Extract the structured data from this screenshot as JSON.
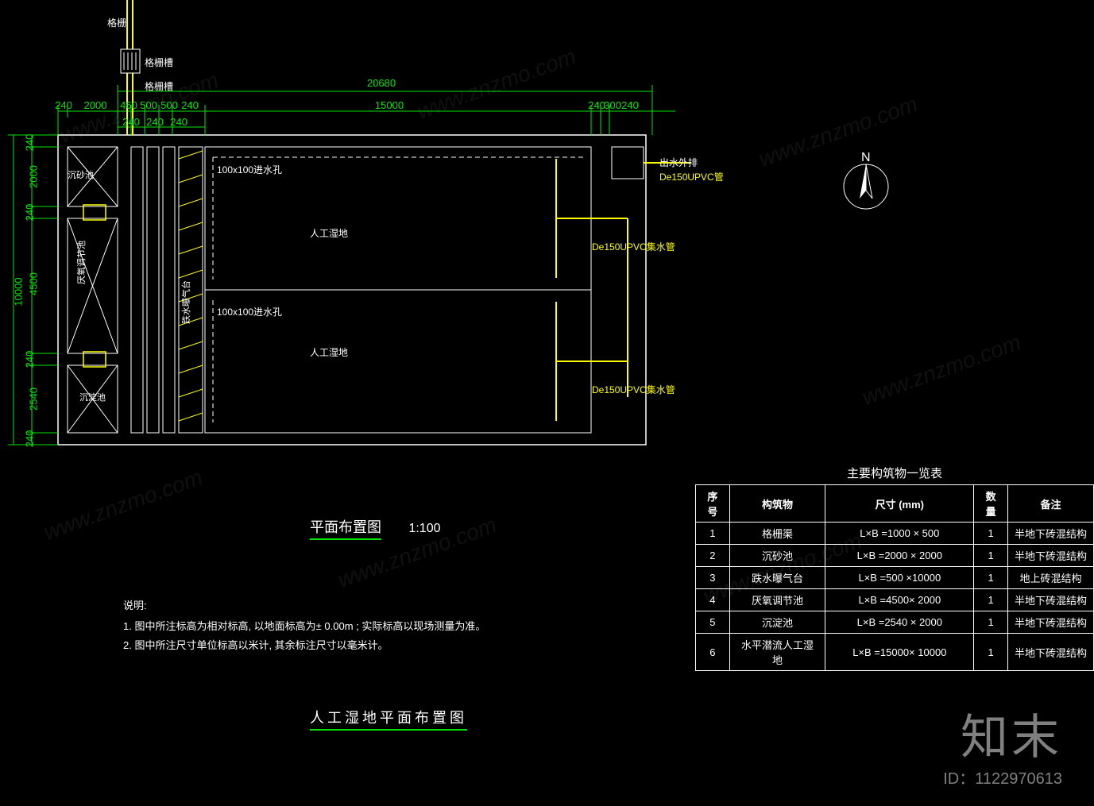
{
  "drawing_title": "人工湿地平面布置图",
  "plan_title": "平面布置图",
  "plan_scale": "1:100",
  "compass": "N",
  "dim_top_overall": "20680",
  "dim_top_segments": [
    "240",
    "2000",
    "460",
    "500",
    "500",
    "240",
    "15000",
    "240",
    "300",
    "240"
  ],
  "dim_top_small": [
    "240",
    "240",
    "240"
  ],
  "dim_left_overall": "10000",
  "dim_left_segments": [
    "240",
    "2000",
    "240",
    "4500",
    "240",
    "2540",
    "240"
  ],
  "labels": {
    "screen_small": "格栅",
    "screen_well": "格栅槽",
    "sump": "沉淀池",
    "wetland": "人工湿地",
    "hole": "100x100进水孔",
    "upvc_pipe": "De150UPVC管",
    "upvc_collect": "De150UPVC集水管",
    "outlet": "出水外排"
  },
  "locals": {
    "sedimentation": "沉砂池",
    "anaerobic": "厌氧调节池",
    "aeration": "跌水曝气台",
    "sedtank": "沉淀池"
  },
  "notes_heading": "说明:",
  "notes": [
    "1.  图中所注标高为相对标高, 以地面标高为±   0.00m   ; 实际标高以现场测量为准。",
    "2.  图中所注尺寸单位标高以米计, 其余标注尺寸以毫米计。"
  ],
  "table_title": "主要构筑物一览表",
  "table_headers": [
    "序号",
    "构筑物",
    "尺寸  (mm)",
    "数量",
    "备注"
  ],
  "table_rows": [
    {
      "n": "1",
      "name": "格栅渠",
      "size": "L×B =1000 × 500",
      "qty": "1",
      "rem": "半地下砖混结构"
    },
    {
      "n": "2",
      "name": "沉砂池",
      "size": "L×B =2000 × 2000",
      "qty": "1",
      "rem": "半地下砖混结构"
    },
    {
      "n": "3",
      "name": "跌水曝气台",
      "size": "L×B =500 ×10000",
      "qty": "1",
      "rem": "地上砖混结构"
    },
    {
      "n": "4",
      "name": "厌氧调节池",
      "size": "L×B =4500× 2000",
      "qty": "1",
      "rem": "半地下砖混结构"
    },
    {
      "n": "5",
      "name": "沉淀池",
      "size": "L×B =2540 ×  2000",
      "qty": "1",
      "rem": "半地下砖混结构"
    },
    {
      "n": "6",
      "name": "水平潜流人工湿地",
      "size": "L×B =15000× 10000",
      "qty": "1",
      "rem": "半地下砖混结构"
    }
  ],
  "watermark_brand": "知末",
  "watermark_id": "ID：1122970613",
  "watermark_diag": "www.znzmo.com"
}
